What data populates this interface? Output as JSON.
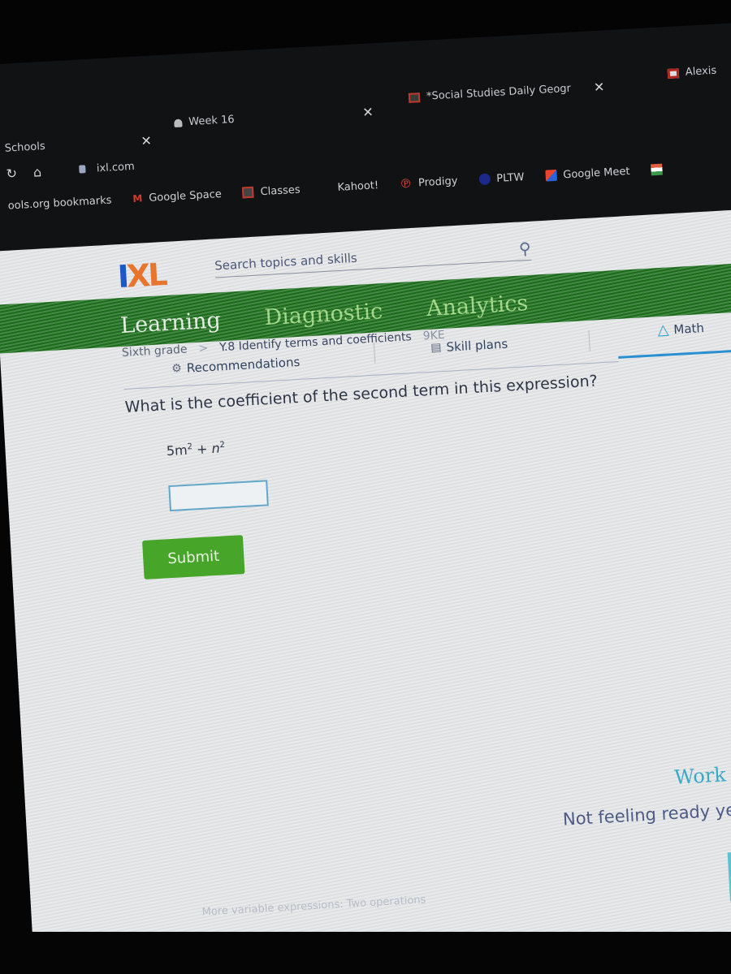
{
  "browser": {
    "tabs": [
      {
        "label": "Schools",
        "has_close": true
      },
      {
        "label": "Week 16",
        "has_close": true
      },
      {
        "label": "*Social Studies Daily Geogr",
        "has_close": true
      },
      {
        "label": "Alexis",
        "has_close": false
      }
    ],
    "url": "ixl.com",
    "bookmarks": [
      {
        "label": "ools.org bookmarks",
        "icon": "none"
      },
      {
        "label": "Google Space",
        "icon": "gmail-icon"
      },
      {
        "label": "Classes",
        "icon": "classroom-icon"
      },
      {
        "label": "Kahoot!",
        "icon": "none"
      },
      {
        "label": "Prodigy",
        "icon": "prodigy-icon"
      },
      {
        "label": "PLTW",
        "icon": "pltw-icon"
      },
      {
        "label": "Google Meet",
        "icon": "meet-icon"
      }
    ]
  },
  "header": {
    "logo_i": "I",
    "logo_xl": "XL",
    "search_placeholder": "Search topics and skills"
  },
  "main_nav": {
    "tabs": [
      {
        "label": "Learning",
        "active": true
      },
      {
        "label": "Diagnostic",
        "active": false
      },
      {
        "label": "Analytics",
        "active": false
      }
    ]
  },
  "sub_nav": {
    "recommendations": "Recommendations",
    "skill_plans": "Skill plans",
    "subject": "Math"
  },
  "breadcrumb": {
    "grade": "Sixth grade",
    "separator": ">",
    "skill": "Y.8 Identify terms and coefficients",
    "code": "9KE"
  },
  "question": {
    "prompt": "What is the coefficient of the second term in this expression?",
    "expr_part1": "5m",
    "expr_exp1": "2",
    "expr_op": " + ",
    "expr_part2": "n",
    "expr_exp2": "2",
    "answer_value": "",
    "submit_label": "Submit"
  },
  "footer": {
    "work_it_out": "Work it ou",
    "not_ready": "Not feeling ready yet?",
    "faint_link": "More variable expressions: Two operations"
  },
  "colors": {
    "nav_green": "#1c6e1c",
    "submit_green": "#47a52a",
    "ixl_blue": "#1f57c6",
    "ixl_orange": "#e8752d",
    "teal": "#3aa9c7"
  }
}
